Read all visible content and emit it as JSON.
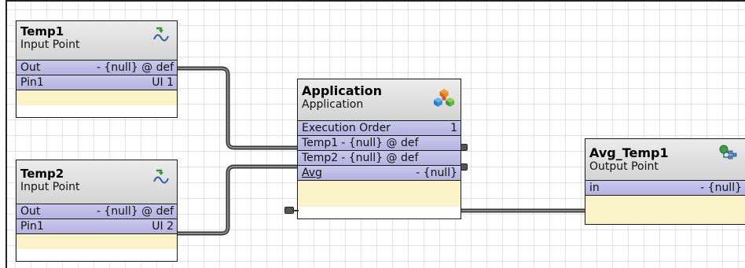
{
  "blocks": {
    "temp1": {
      "title": "Temp1",
      "subtitle": "Input Point",
      "icon": "input-point-icon",
      "rows": [
        {
          "name": "Out",
          "value": "- {null} @ def"
        },
        {
          "name": "Pin1",
          "value": "UI 1"
        }
      ]
    },
    "temp2": {
      "title": "Temp2",
      "subtitle": "Input Point",
      "icon": "input-point-icon",
      "rows": [
        {
          "name": "Out",
          "value": "- {null} @ def"
        },
        {
          "name": "Pin1",
          "value": "UI 2"
        }
      ]
    },
    "application": {
      "title": "Application",
      "subtitle": "Application",
      "icon": "application-icon",
      "rows": [
        {
          "name": "Execution Order",
          "value": "1"
        },
        {
          "name": "Temp1",
          "value": "- {null} @ def"
        },
        {
          "name": "Temp2",
          "value": "- {null} @ def"
        },
        {
          "name": "Avg",
          "value": "- {null}"
        }
      ]
    },
    "avg_temp1": {
      "title": "Avg_Temp1",
      "subtitle": "Output Point",
      "icon": "output-point-icon",
      "rows": [
        {
          "name": "in",
          "value": "- {null}"
        }
      ]
    }
  },
  "colors": {
    "header": "#dcdcdc",
    "row": "#bebde6",
    "footer": "#faf3c8",
    "wire": "#555555"
  }
}
